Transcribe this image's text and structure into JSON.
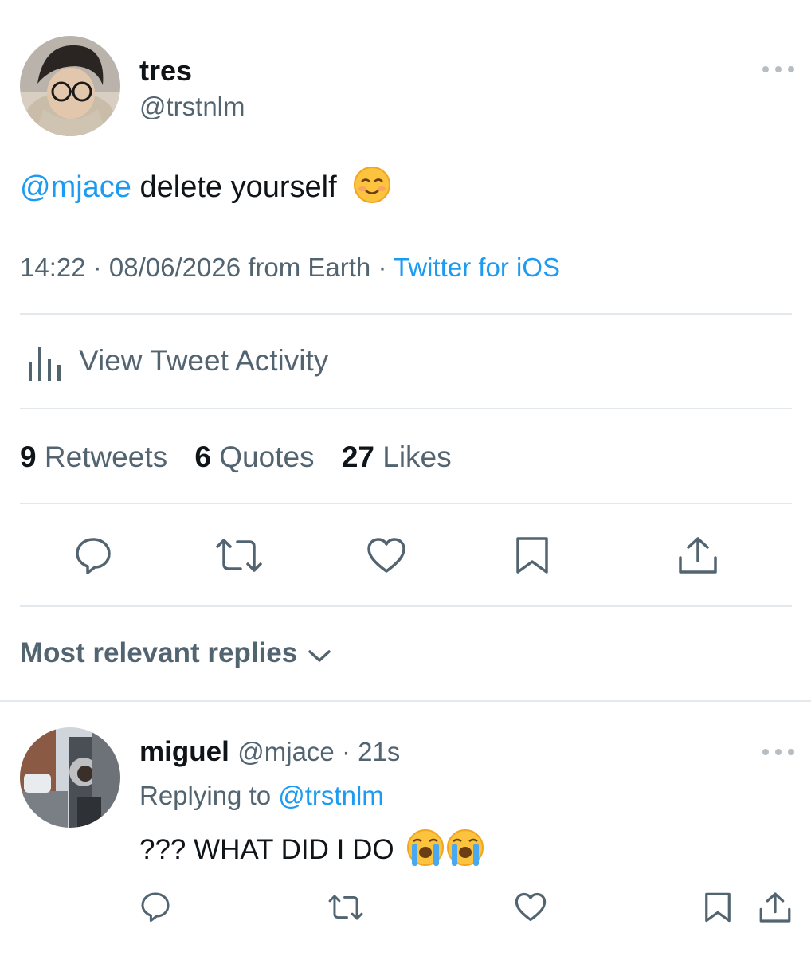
{
  "tweet": {
    "author": {
      "display_name": "tres",
      "handle": "@trstnlm",
      "avatar": "profile-photo-glasses"
    },
    "text": {
      "mention": "@mjace",
      "body": " delete yourself",
      "emoji": "smiling-face-emoji"
    },
    "meta": {
      "time_date": "14:22 · 08/06/2026 from Earth · ",
      "source": "Twitter for iOS"
    },
    "activity_label": "View Tweet Activity",
    "stats": [
      {
        "count": "9",
        "label": "Retweets"
      },
      {
        "count": "6",
        "label": "Quotes"
      },
      {
        "count": "27",
        "label": "Likes"
      }
    ],
    "actions": [
      "reply-icon",
      "retweet-icon",
      "like-icon",
      "bookmark-icon",
      "share-icon"
    ]
  },
  "replies_section": {
    "title": "Most relevant replies"
  },
  "reply": {
    "display_name": "miguel",
    "handle_time": "@mjace · 21s",
    "replying_prefix": "Replying to ",
    "replying_to": "@trstnlm",
    "text": "??? WHAT DID I DO",
    "emoji": "loudly-crying-face-emoji",
    "avatar": "profile-photo-street"
  },
  "colors": {
    "accent": "#1d9bf0",
    "text": "#0f1419",
    "muted": "#536471",
    "divider": "#e2e8ec"
  }
}
